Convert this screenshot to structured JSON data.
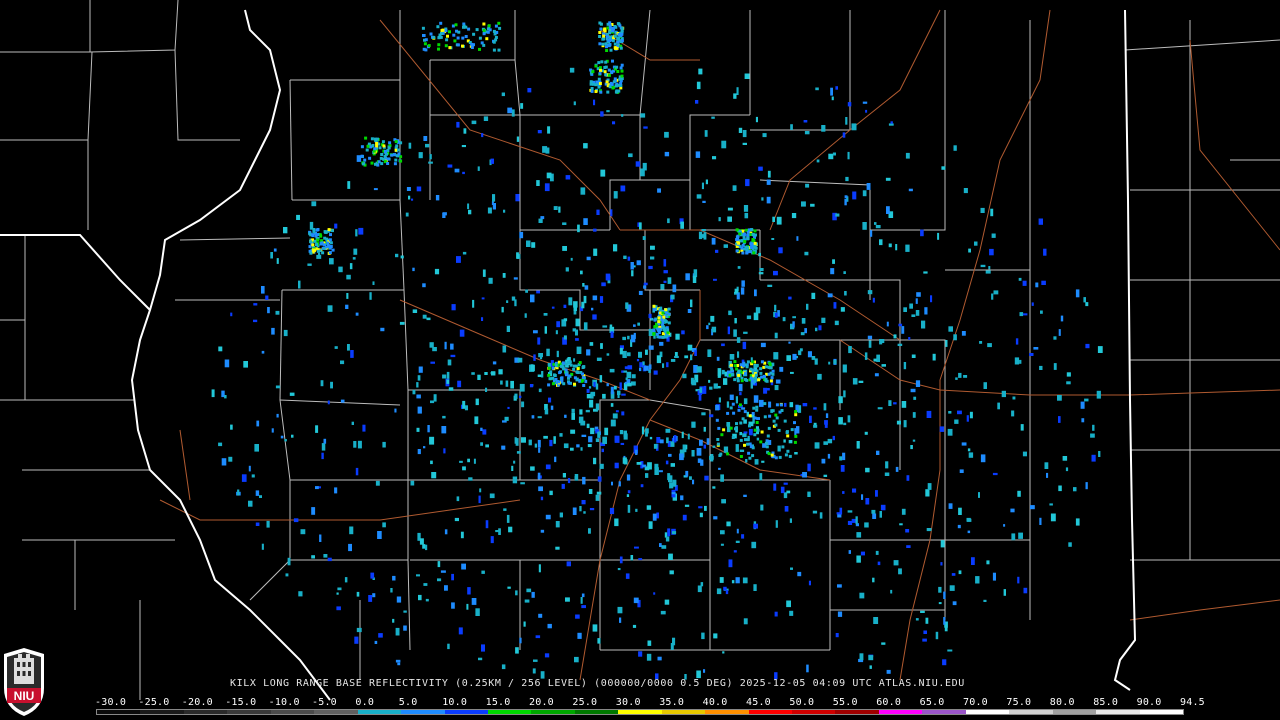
{
  "product": {
    "caption": "KILX LONG RANGE BASE REFLECTIVITY (0.25KM / 256 LEVEL) (000000/0000 0.5 DEG) 2025-12-05 04:09 UTC  ATLAS.NIU.EDU",
    "logo_text": "NIU"
  },
  "colorbar": {
    "labels": [
      "-30.0",
      "-25.0",
      "-20.0",
      "-15.0",
      "-10.0",
      "-5.0",
      "0.0",
      "5.0",
      "10.0",
      "15.0",
      "20.0",
      "25.0",
      "30.0",
      "35.0",
      "40.0",
      "45.0",
      "50.0",
      "55.0",
      "60.0",
      "65.0",
      "70.0",
      "75.0",
      "80.0",
      "85.0",
      "90.0",
      "94.5"
    ],
    "colors": [
      "#0a0a0a",
      "#1a1a1a",
      "#2a2a2a",
      "#3a3a3a",
      "#4c4c4c",
      "#606060",
      "#18b0c8",
      "#1e8cff",
      "#0a3cff",
      "#00d800",
      "#00a800",
      "#007800",
      "#ffff00",
      "#e6c800",
      "#ff9000",
      "#ff0000",
      "#d00000",
      "#a00000",
      "#ff00ff",
      "#9a55c9",
      "#ffffff",
      "#d0d0d0",
      "#a0a0a0",
      "#e8e8e8",
      "#ffffff"
    ]
  },
  "colors": {
    "background": "#000000",
    "county_border": "#bcbcbc",
    "state_border": "#ffffff",
    "highway": "#b05a30"
  }
}
